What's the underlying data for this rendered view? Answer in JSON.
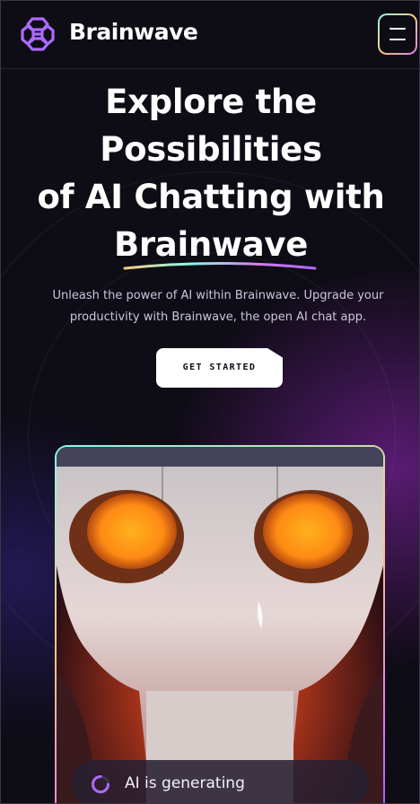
{
  "app": {
    "name": "Brainwave"
  },
  "header": {
    "logo_text": "Brainwave",
    "menu_icon": "hamburger-menu-icon"
  },
  "hero": {
    "title_line1": "Explore the",
    "title_line2": "Possibilities",
    "title_line3": "of AI Chatting with",
    "title_line4": "Brainwave",
    "subtitle": "Unleash the power of AI within Brainwave. Upgrade your productivity with Brainwave, the open AI chat app.",
    "cta_label": "GET STARTED"
  },
  "preview": {
    "status_text": "AI is generating",
    "status_icon": "loading-spinner-icon",
    "image_subject": "robot-face-image"
  },
  "colors": {
    "background": "#0e0c15",
    "accent_purple": "#ac6aff",
    "gradient_teal": "#89f9e8",
    "gradient_yellow": "#facb7b",
    "gradient_pink": "#d87cee",
    "text_muted": "#cac6dd"
  }
}
